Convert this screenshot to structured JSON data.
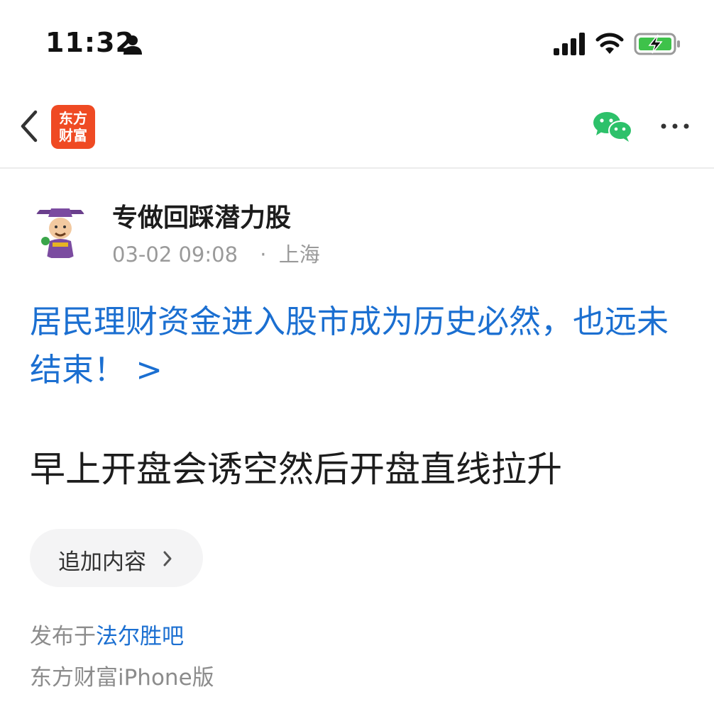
{
  "status_bar": {
    "time": "11:32",
    "icons": [
      "person-icon",
      "signal-icon",
      "wifi-icon",
      "battery-charging-icon"
    ],
    "battery_color": "#3ec24a"
  },
  "nav": {
    "logo_line1": "东方",
    "logo_line2": "财富",
    "logo_color": "#ef4a23",
    "icons": [
      "back-icon",
      "wechat-icon",
      "more-icon"
    ]
  },
  "author": {
    "name": "专做回踩潜力股",
    "date": "03-02 09:08",
    "separator": "·",
    "location": "上海"
  },
  "promo_link": {
    "text": "居民理财资金进入股市成为历史必然，也远未结束！ >",
    "color": "#1b6fd1"
  },
  "post": {
    "content": "早上开盘会诱空然后开盘直线拉升"
  },
  "add_button": {
    "label": "追加内容"
  },
  "footer": {
    "publish_prefix": "发布于",
    "forum": "法尔胜吧",
    "device": "东方财富iPhone版"
  }
}
